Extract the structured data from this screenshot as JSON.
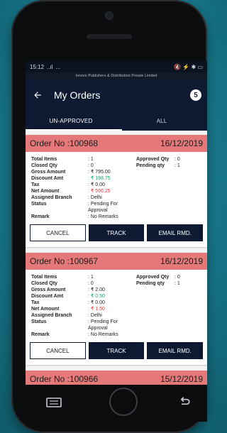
{
  "status": {
    "time": "15:12",
    "signal": "..ıl",
    "extra": "...",
    "right_icons": "🔇 ⚡ ✱ ▭"
  },
  "company_line": "Innovo Publishers & Distribution Private Limited",
  "appbar": {
    "title": "My Orders",
    "count": "5"
  },
  "tabs": [
    {
      "label": "UN-APPROVED"
    },
    {
      "label": "ALL"
    }
  ],
  "orders": [
    {
      "order_label": "Order No :100968",
      "date": "16/12/2019",
      "left": [
        {
          "k": "Total Items",
          "v": ": 1"
        },
        {
          "k": "Closed Qty",
          "v": ": 0"
        },
        {
          "k": "Gross Amount",
          "v": ": ₹ 795.00"
        },
        {
          "k": "Discount Amt",
          "v": ": ₹ 198.75"
        },
        {
          "k": "Tax",
          "v": ": ₹ 0.00"
        },
        {
          "k": "Net Amount",
          "v": ": ₹ 596.25"
        },
        {
          "k": "Assigned Branch",
          "v": ": Delhi"
        },
        {
          "k": "Status",
          "v": ": Pending For Approval"
        },
        {
          "k": "Remark",
          "v": ": No Remarks"
        }
      ],
      "right": [
        {
          "k": "Approved Qty",
          "v": ": 0"
        },
        {
          "k": "Pending qty",
          "v": ": 1"
        }
      ],
      "buttons": {
        "cancel": "CANCEL",
        "track": "TRACK",
        "email": "EMAIL RMD."
      }
    },
    {
      "order_label": "Order No :100967",
      "date": "16/12/2019",
      "left": [
        {
          "k": "Total Items",
          "v": ": 1"
        },
        {
          "k": "Closed Qty",
          "v": ": 0"
        },
        {
          "k": "Gross Amount",
          "v": ": ₹ 2.00"
        },
        {
          "k": "Discount Amt",
          "v": ": ₹ 0.50"
        },
        {
          "k": "Tax",
          "v": ": ₹ 0.00"
        },
        {
          "k": "Net Amount",
          "v": ": ₹ 1.50"
        },
        {
          "k": "Assigned Branch",
          "v": ": Delhi"
        },
        {
          "k": "Status",
          "v": ": Pending For Approval"
        },
        {
          "k": "Remark",
          "v": ": No Remarks"
        }
      ],
      "right": [
        {
          "k": "Approved Qty",
          "v": ": 0"
        },
        {
          "k": "Pending qty",
          "v": ": 1"
        }
      ],
      "buttons": {
        "cancel": "CANCEL",
        "track": "TRACK",
        "email": "EMAIL RMD."
      }
    },
    {
      "order_label": "Order No :100966",
      "date": "15/12/2019"
    }
  ],
  "colors": {
    "header": "#0e1a31",
    "order_header": "#e5797a",
    "green": "#19a55f",
    "red": "#e03a3a"
  }
}
